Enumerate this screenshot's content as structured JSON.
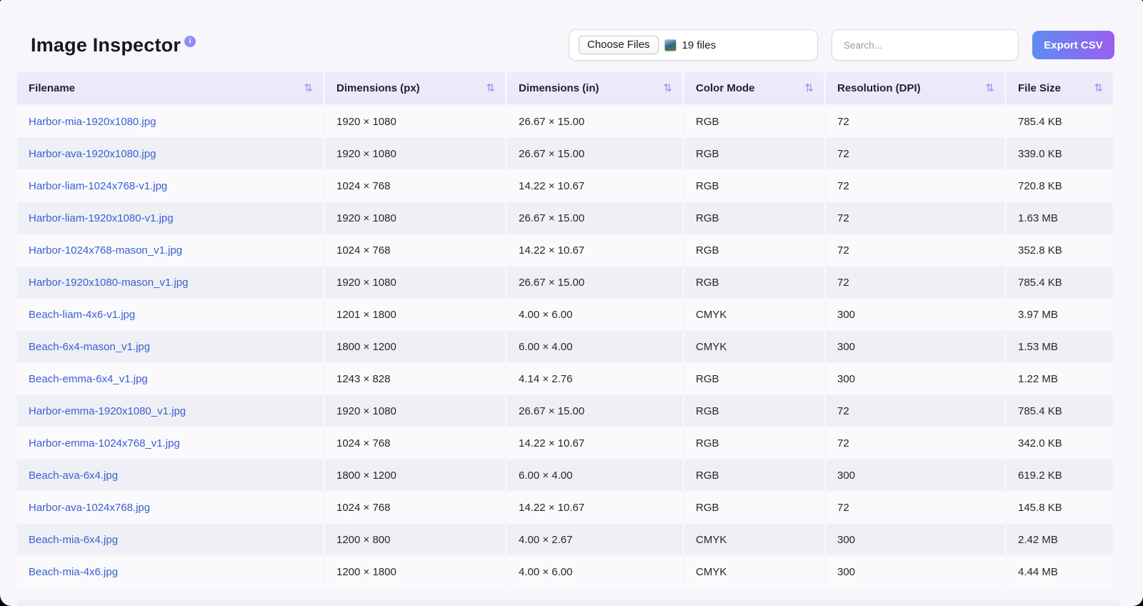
{
  "app": {
    "title": "Image Inspector"
  },
  "toolbar": {
    "choose_files_label": "Choose Files",
    "files_count": "19 files",
    "search_placeholder": "Search...",
    "export_label": "Export CSV"
  },
  "icons": {
    "info": "i",
    "sort": "⇅"
  },
  "colors": {
    "accent_gradient_start": "#5f8cf3",
    "accent_gradient_end": "#9b5ef0",
    "header_bg": "#ebe9fa",
    "link_blue": "#3a5fd0",
    "row_even_bg": "#eef0f5",
    "row_odd_bg": "#fafafd",
    "info_badge_bg": "#8f8df3"
  },
  "table": {
    "columns": [
      {
        "label": "Filename"
      },
      {
        "label": "Dimensions (px)"
      },
      {
        "label": "Dimensions (in)"
      },
      {
        "label": "Color Mode"
      },
      {
        "label": "Resolution (DPI)"
      },
      {
        "label": "File Size"
      }
    ],
    "rows": [
      {
        "filename": "Harbor-mia-1920x1080.jpg",
        "px": "1920 × 1080",
        "inches": "26.67 × 15.00",
        "mode": "RGB",
        "dpi": "72",
        "size": "785.4 KB"
      },
      {
        "filename": "Harbor-ava-1920x1080.jpg",
        "px": "1920 × 1080",
        "inches": "26.67 × 15.00",
        "mode": "RGB",
        "dpi": "72",
        "size": "339.0 KB"
      },
      {
        "filename": "Harbor-liam-1024x768-v1.jpg",
        "px": "1024 × 768",
        "inches": "14.22 × 10.67",
        "mode": "RGB",
        "dpi": "72",
        "size": "720.8 KB"
      },
      {
        "filename": "Harbor-liam-1920x1080-v1.jpg",
        "px": "1920 × 1080",
        "inches": "26.67 × 15.00",
        "mode": "RGB",
        "dpi": "72",
        "size": "1.63 MB"
      },
      {
        "filename": "Harbor-1024x768-mason_v1.jpg",
        "px": "1024 × 768",
        "inches": "14.22 × 10.67",
        "mode": "RGB",
        "dpi": "72",
        "size": "352.8 KB"
      },
      {
        "filename": "Harbor-1920x1080-mason_v1.jpg",
        "px": "1920 × 1080",
        "inches": "26.67 × 15.00",
        "mode": "RGB",
        "dpi": "72",
        "size": "785.4 KB"
      },
      {
        "filename": "Beach-liam-4x6-v1.jpg",
        "px": "1201 × 1800",
        "inches": "4.00 × 6.00",
        "mode": "CMYK",
        "dpi": "300",
        "size": "3.97 MB"
      },
      {
        "filename": "Beach-6x4-mason_v1.jpg",
        "px": "1800 × 1200",
        "inches": "6.00 × 4.00",
        "mode": "CMYK",
        "dpi": "300",
        "size": "1.53 MB"
      },
      {
        "filename": "Beach-emma-6x4_v1.jpg",
        "px": "1243 × 828",
        "inches": "4.14 × 2.76",
        "mode": "RGB",
        "dpi": "300",
        "size": "1.22 MB"
      },
      {
        "filename": "Harbor-emma-1920x1080_v1.jpg",
        "px": "1920 × 1080",
        "inches": "26.67 × 15.00",
        "mode": "RGB",
        "dpi": "72",
        "size": "785.4 KB"
      },
      {
        "filename": "Harbor-emma-1024x768_v1.jpg",
        "px": "1024 × 768",
        "inches": "14.22 × 10.67",
        "mode": "RGB",
        "dpi": "72",
        "size": "342.0 KB"
      },
      {
        "filename": "Beach-ava-6x4.jpg",
        "px": "1800 × 1200",
        "inches": "6.00 × 4.00",
        "mode": "RGB",
        "dpi": "300",
        "size": "619.2 KB"
      },
      {
        "filename": "Harbor-ava-1024x768.jpg",
        "px": "1024 × 768",
        "inches": "14.22 × 10.67",
        "mode": "RGB",
        "dpi": "72",
        "size": "145.8 KB"
      },
      {
        "filename": "Beach-mia-6x4.jpg",
        "px": "1200 × 800",
        "inches": "4.00 × 2.67",
        "mode": "CMYK",
        "dpi": "300",
        "size": "2.42 MB"
      },
      {
        "filename": "Beach-mia-4x6.jpg",
        "px": "1200 × 1800",
        "inches": "4.00 × 6.00",
        "mode": "CMYK",
        "dpi": "300",
        "size": "4.44 MB"
      }
    ]
  }
}
